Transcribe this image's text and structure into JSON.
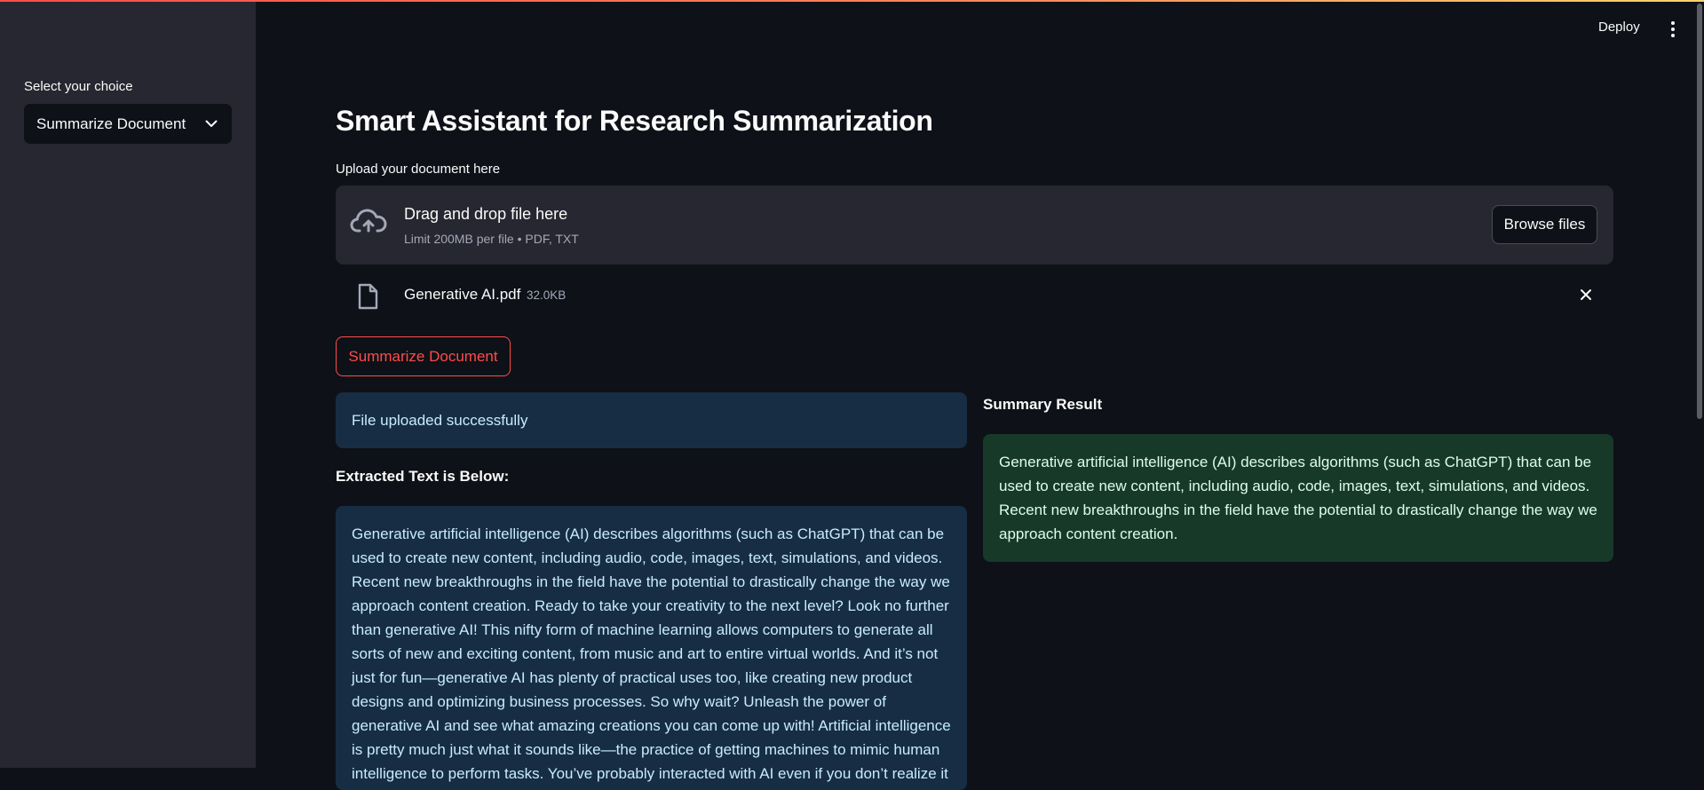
{
  "sidebar": {
    "select_label": "Select your choice",
    "selected_option": "Summarize Document"
  },
  "header": {
    "deploy_label": "Deploy"
  },
  "main": {
    "title": "Smart Assistant for Research Summarization",
    "upload": {
      "label": "Upload your document here",
      "drop_title": "Drag and drop file here",
      "limit_text": "Limit 200MB per file • PDF, TXT",
      "browse_label": "Browse files"
    },
    "file": {
      "name": "Generative AI.pdf",
      "size": "32.0KB"
    },
    "summarize_button": "Summarize Document",
    "info_message": "File uploaded successfully",
    "extracted_label": "Extracted Text is Below:",
    "extracted_text": "Generative artificial intelligence (AI) describes algorithms (such as ChatGPT) that can be used to create new content, including audio, code, images, text, simulations, and videos. Recent new breakthroughs in the field have the potential to drastically change the way we approach content creation. Ready to take your creativity to the next level? Look no further than generative AI! This nifty form of machine learning allows computers to generate all sorts of new and exciting content, from music and art to entire virtual worlds. And it’s not just for fun—generative AI has plenty of practical uses too, like creating new product designs and optimizing business processes. So why wait? Unleash the power of generative AI and see what amazing creations you can come up with! Artificial intelligence is pretty much just what it sounds like—the practice of getting machines to mimic human intelligence to perform tasks. You’ve probably interacted with AI even if you don’t realize it",
    "summary_label": "Summary Result",
    "summary_text": "Generative artificial intelligence (AI) describes algorithms (such as ChatGPT) that can be used to create new content, including audio, code, images, text, simulations, and videos. Recent new breakthroughs in the field have the potential to drastically change the way we approach content creation."
  },
  "colors": {
    "accent": "#ff4b4b",
    "info_bg": "#172d43",
    "success_bg": "#173928",
    "sidebar_bg": "#262730",
    "app_bg": "#0e1117"
  },
  "icons": {
    "upload": "cloud-upload-icon",
    "file": "file-icon",
    "close": "close-icon",
    "menu": "more-vertical-icon",
    "dropdown": "chevron-down-icon"
  }
}
